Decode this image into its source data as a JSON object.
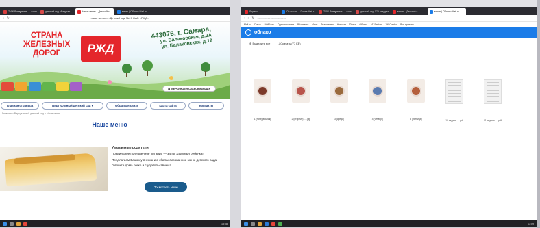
{
  "left_browser": {
    "tabs": [
      {
        "label": "ТИЖ Внедрение — Аннот...",
        "fav": "#d83c3c"
      },
      {
        "label": "детский сад «Радуга»",
        "fav": "#d64a4a"
      },
      {
        "label": "Наше меню – Детский с",
        "fav": "#e4262b",
        "active": true
      },
      {
        "label": "меню | Облако Mail.ru",
        "fav": "#1b7ce8"
      }
    ],
    "address": "наше меню – «Детский сад №17 ОАО «РЖД»"
  },
  "site": {
    "brand_lines": [
      "СТРАНА",
      "ЖЕЛЕЗНЫХ",
      "ДОРОГ"
    ],
    "logo_text": "РЖД",
    "address_lines": [
      "443076, г. Самара,",
      "ул. Балаковская, д.2А",
      "ул. Балаковская, д.12"
    ],
    "vision_button": "ВЕРСИЯ ДЛЯ СЛАБОВИДЯЩИХ",
    "menu": [
      "Главная страница",
      "Виртуальный детский сад ▾",
      "Обратная связь",
      "Карта сайта",
      "Контакты"
    ],
    "breadcrumb": "Главная > Виртуальный детский сад > Наше меню",
    "page_title": "Наше меню",
    "greeting": {
      "heading": "Уважаемые родители!",
      "p1": "Правильное полноценное питание — залог здоровья ребенка!",
      "p2": "Предлагаем Вашему вниманию сбалансированное меню детского сада",
      "p3": "Готовьте дома легко и с удовольствием!"
    },
    "cta": "Посмотреть меню"
  },
  "right_browser": {
    "tabs": [
      {
        "label": "Яндекс",
        "fav": "#e4262b"
      },
      {
        "label": "Ох почта — Почта Mail.r",
        "fav": "#1b7ce8"
      },
      {
        "label": "ТИЖ Внедрение — Аннот",
        "fav": "#d83c3c"
      },
      {
        "label": "детский сад 175 внедрен",
        "fav": "#d64a4a"
      },
      {
        "label": "меню – Детский с",
        "fav": "#e4262b"
      },
      {
        "label": "меню | Облако Mail.ru",
        "fav": "#1b7ce8",
        "active": true
      }
    ],
    "bookmarks": [
      "Mail.ru",
      "Почта",
      "Мой Мир",
      "Одноклассники",
      "ВКонтакте",
      "Игры",
      "Знакомства",
      "Новости",
      "Поиск",
      "Облако",
      "VK Работа",
      "VK Combo",
      "Все проекты"
    ],
    "cloud": {
      "name": "облако",
      "actions": [
        "Выделить все",
        "Скачать (77 КБ)"
      ],
      "files": [
        {
          "name": "1 (понедельник)",
          "kind": "photo",
          "plate": "#7c3a2a"
        },
        {
          "name": "2 (вторник) ... .jpg",
          "kind": "photo",
          "plate": "#b8544b"
        },
        {
          "name": "3 (среда)",
          "kind": "photo",
          "plate": "#9a6a3c"
        },
        {
          "name": "4 (четверг)",
          "kind": "photo",
          "plate": "#5a7bb0"
        },
        {
          "name": "5 (пятница)",
          "kind": "photo",
          "plate": "#b55f3c"
        },
        {
          "name": "10 неделя ... .pdf",
          "kind": "doc"
        },
        {
          "name": "11 неделя ... .pdf",
          "kind": "doc"
        }
      ]
    }
  },
  "taskbar": {
    "clock_left": "13:08",
    "clock_right": "13:09"
  }
}
